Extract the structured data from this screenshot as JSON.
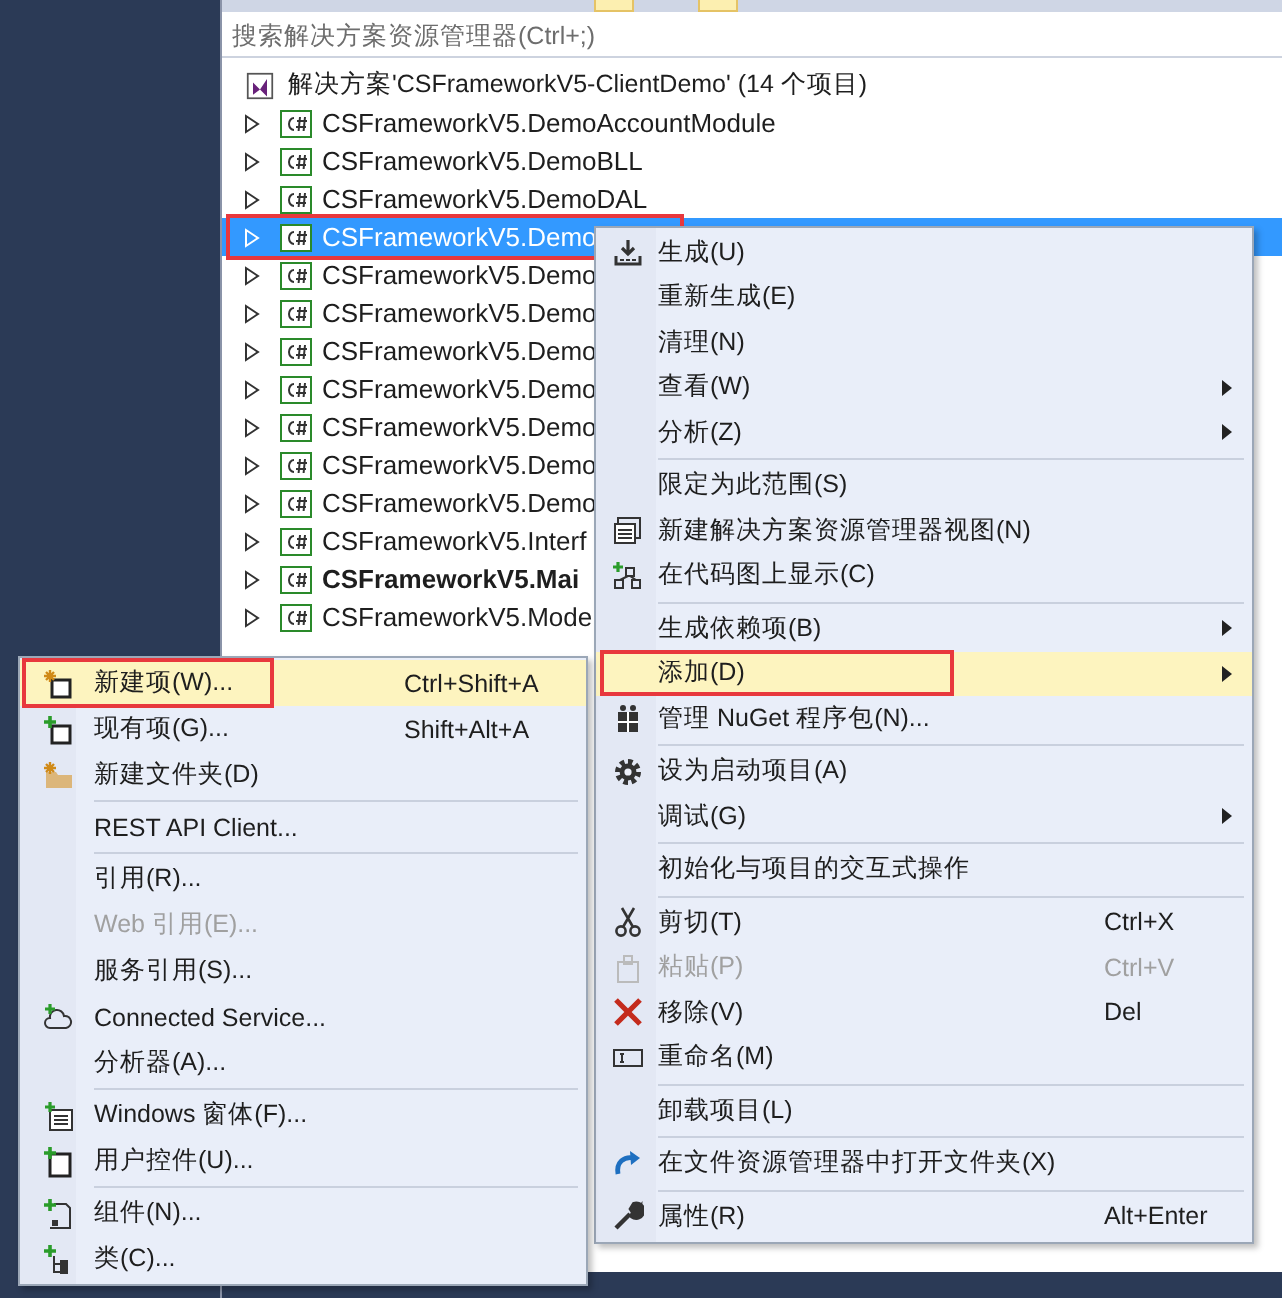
{
  "search": {
    "placeholder": "搜索解决方案资源管理器(Ctrl+;)"
  },
  "solution": {
    "label": "解决方案'CSFrameworkV5-ClientDemo' (14 个项目)"
  },
  "projects": [
    {
      "label": "CSFrameworkV5.DemoAccountModule",
      "selected": false,
      "bold": false,
      "outlined": false
    },
    {
      "label": "CSFrameworkV5.DemoBLL",
      "selected": false,
      "bold": false,
      "outlined": false
    },
    {
      "label": "CSFrameworkV5.DemoDAL",
      "selected": false,
      "bold": false,
      "outlined": false
    },
    {
      "label": "CSFrameworkV5.Demo",
      "selected": true,
      "bold": false,
      "outlined": true
    },
    {
      "label": "CSFrameworkV5.Demo",
      "selected": false,
      "bold": false,
      "outlined": false
    },
    {
      "label": "CSFrameworkV5.Demo",
      "selected": false,
      "bold": false,
      "outlined": false
    },
    {
      "label": "CSFrameworkV5.Demo",
      "selected": false,
      "bold": false,
      "outlined": false
    },
    {
      "label": "CSFrameworkV5.Demo",
      "selected": false,
      "bold": false,
      "outlined": false
    },
    {
      "label": "CSFrameworkV5.Demo",
      "selected": false,
      "bold": false,
      "outlined": false
    },
    {
      "label": "CSFrameworkV5.Demo",
      "selected": false,
      "bold": false,
      "outlined": false
    },
    {
      "label": "CSFrameworkV5.Demo",
      "selected": false,
      "bold": false,
      "outlined": false
    },
    {
      "label": "CSFrameworkV5.Interf",
      "selected": false,
      "bold": false,
      "outlined": false
    },
    {
      "label": "CSFrameworkV5.Mai",
      "selected": false,
      "bold": true,
      "outlined": false
    },
    {
      "label": "CSFrameworkV5.Mode",
      "selected": false,
      "bold": false,
      "outlined": false
    }
  ],
  "context_menu": {
    "items": [
      {
        "kind": "item",
        "label": "生成(U)",
        "submenu": false,
        "disabled": false,
        "selected": false,
        "outlined": false
      },
      {
        "kind": "item",
        "label": "重新生成(E)",
        "submenu": false,
        "disabled": false,
        "selected": false,
        "outlined": false
      },
      {
        "kind": "item",
        "label": "清理(N)",
        "submenu": false,
        "disabled": false,
        "selected": false,
        "outlined": false
      },
      {
        "kind": "item",
        "label": "查看(W)",
        "submenu": true,
        "disabled": false,
        "selected": false,
        "outlined": false
      },
      {
        "kind": "item",
        "label": "分析(Z)",
        "submenu": true,
        "disabled": false,
        "selected": false,
        "outlined": false
      },
      {
        "kind": "separator"
      },
      {
        "kind": "item",
        "label": "限定为此范围(S)",
        "submenu": false,
        "disabled": false,
        "selected": false,
        "outlined": false
      },
      {
        "kind": "item",
        "label": "新建解决方案资源管理器视图(N)",
        "submenu": false,
        "disabled": false,
        "selected": false,
        "outlined": false
      },
      {
        "kind": "item",
        "label": "在代码图上显示(C)",
        "submenu": false,
        "disabled": false,
        "selected": false,
        "outlined": false
      },
      {
        "kind": "separator"
      },
      {
        "kind": "item",
        "label": "生成依赖项(B)",
        "submenu": true,
        "disabled": false,
        "selected": false,
        "outlined": false
      },
      {
        "kind": "item",
        "label": "添加(D)",
        "submenu": true,
        "disabled": false,
        "selected": true,
        "outlined": true
      },
      {
        "kind": "item",
        "label": "管理 NuGet 程序包(N)...",
        "submenu": false,
        "disabled": false,
        "selected": false,
        "outlined": false
      },
      {
        "kind": "separator"
      },
      {
        "kind": "item",
        "label": "设为启动项目(A)",
        "submenu": false,
        "disabled": false,
        "selected": false,
        "outlined": false
      },
      {
        "kind": "item",
        "label": "调试(G)",
        "submenu": true,
        "disabled": false,
        "selected": false,
        "outlined": false
      },
      {
        "kind": "separator"
      },
      {
        "kind": "item",
        "label": "初始化与项目的交互式操作",
        "submenu": false,
        "disabled": false,
        "selected": false,
        "outlined": false
      },
      {
        "kind": "separator"
      },
      {
        "kind": "item",
        "label": "剪切(T)",
        "shortcut": "Ctrl+X",
        "submenu": false,
        "disabled": false,
        "selected": false,
        "outlined": false
      },
      {
        "kind": "item",
        "label": "粘贴(P)",
        "shortcut": "Ctrl+V",
        "submenu": false,
        "disabled": true,
        "selected": false,
        "outlined": false
      },
      {
        "kind": "item",
        "label": "移除(V)",
        "shortcut": "Del",
        "submenu": false,
        "disabled": false,
        "selected": false,
        "outlined": false
      },
      {
        "kind": "item",
        "label": "重命名(M)",
        "submenu": false,
        "disabled": false,
        "selected": false,
        "outlined": false
      },
      {
        "kind": "separator"
      },
      {
        "kind": "item",
        "label": "卸载项目(L)",
        "submenu": false,
        "disabled": false,
        "selected": false,
        "outlined": false
      },
      {
        "kind": "separator"
      },
      {
        "kind": "item",
        "label": "在文件资源管理器中打开文件夹(X)",
        "submenu": false,
        "disabled": false,
        "selected": false,
        "outlined": false
      },
      {
        "kind": "separator"
      },
      {
        "kind": "item",
        "label": "属性(R)",
        "shortcut": "Alt+Enter",
        "submenu": false,
        "disabled": false,
        "selected": false,
        "outlined": false
      }
    ]
  },
  "add_submenu": {
    "items": [
      {
        "kind": "item",
        "label": "新建项(W)...",
        "shortcut": "Ctrl+Shift+A",
        "disabled": false,
        "selected": true,
        "outlined": true
      },
      {
        "kind": "item",
        "label": "现有项(G)...",
        "shortcut": "Shift+Alt+A",
        "disabled": false,
        "selected": false,
        "outlined": false
      },
      {
        "kind": "item",
        "label": "新建文件夹(D)",
        "disabled": false,
        "selected": false,
        "outlined": false
      },
      {
        "kind": "separator"
      },
      {
        "kind": "item",
        "label": "REST API Client...",
        "disabled": false,
        "selected": false,
        "outlined": false
      },
      {
        "kind": "separator"
      },
      {
        "kind": "item",
        "label": "引用(R)...",
        "disabled": false,
        "selected": false,
        "outlined": false
      },
      {
        "kind": "item",
        "label": "Web 引用(E)...",
        "disabled": true,
        "selected": false,
        "outlined": false
      },
      {
        "kind": "item",
        "label": "服务引用(S)...",
        "disabled": false,
        "selected": false,
        "outlined": false
      },
      {
        "kind": "item",
        "label": "Connected Service...",
        "disabled": false,
        "selected": false,
        "outlined": false
      },
      {
        "kind": "item",
        "label": "分析器(A)...",
        "disabled": false,
        "selected": false,
        "outlined": false
      },
      {
        "kind": "separator"
      },
      {
        "kind": "item",
        "label": "Windows 窗体(F)...",
        "disabled": false,
        "selected": false,
        "outlined": false
      },
      {
        "kind": "item",
        "label": "用户控件(U)...",
        "disabled": false,
        "selected": false,
        "outlined": false
      },
      {
        "kind": "separator"
      },
      {
        "kind": "item",
        "label": "组件(N)...",
        "disabled": false,
        "selected": false,
        "outlined": false
      },
      {
        "kind": "item",
        "label": "类(C)...",
        "disabled": false,
        "selected": false,
        "outlined": false
      }
    ]
  }
}
